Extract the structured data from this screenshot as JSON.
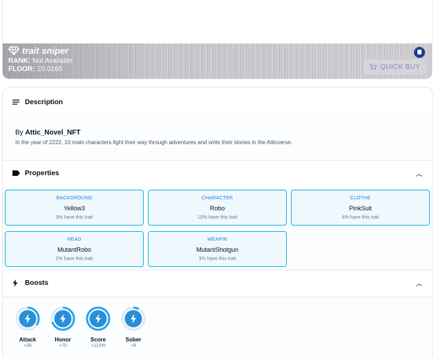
{
  "sniper": {
    "title": "trait sniper",
    "rank_label": "RANK:",
    "rank_value": "Not Available",
    "floor_label": "FLOOR:",
    "floor_value": "Ξ0.0165",
    "quick_buy_label": "QUICK BUY"
  },
  "description": {
    "heading": "Description",
    "by_prefix": "By",
    "creator": "Attic_Novel_NFT",
    "text": "In the year of 2222, 10 main characters fight their way through adventures and write their stories in the Atticverse."
  },
  "properties": {
    "heading": "Properties",
    "items": [
      {
        "type": "BACKGROUND",
        "value": "Yellow3",
        "rarity": "3% have this trait"
      },
      {
        "type": "CHARACTER",
        "value": "Robo",
        "rarity": "10% have this trait"
      },
      {
        "type": "CLOTHE",
        "value": "PinkSuit",
        "rarity": "4% have this trait"
      },
      {
        "type": "HEAD",
        "value": "MutantRobo",
        "rarity": "2% have this trait"
      },
      {
        "type": "WEAPIN",
        "value": "MutantShotgun",
        "rarity": "3% have this trait"
      }
    ]
  },
  "boosts": {
    "heading": "Boosts",
    "items": [
      {
        "label": "Attack",
        "value": "+35",
        "fill": 0.35
      },
      {
        "label": "Honor",
        "value": "+70",
        "fill": 0.7
      },
      {
        "label": "Score",
        "value": "+113%",
        "fill": 1.0
      },
      {
        "label": "Sober",
        "value": "+8",
        "fill": 0.08
      }
    ]
  },
  "colors": {
    "accent": "#2081e2",
    "trait_border": "#15b2e5",
    "boost_ring": "#29a4e8",
    "boost_disc": "#2a8fd8"
  }
}
